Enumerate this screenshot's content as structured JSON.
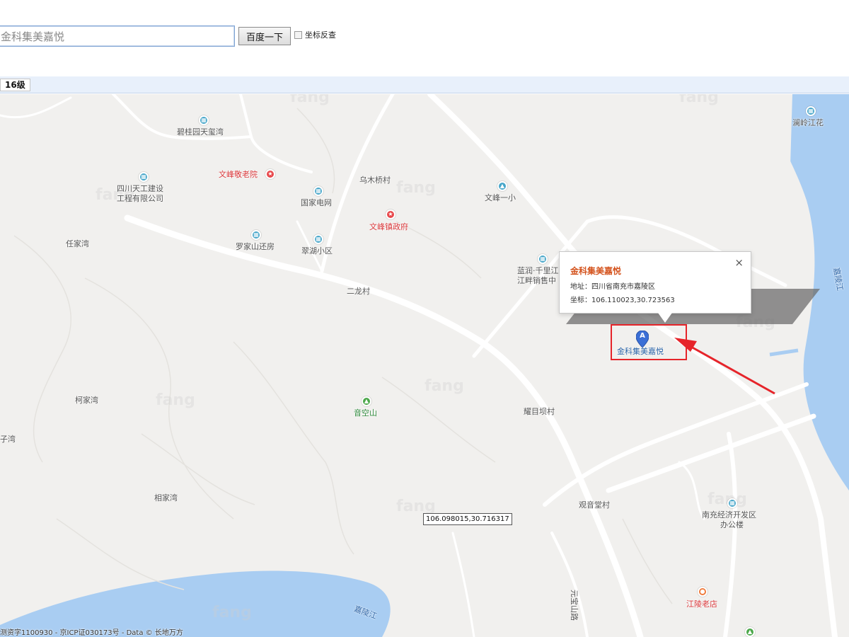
{
  "search": {
    "value": "金科集美嘉悦",
    "button_label": "百度一下",
    "checkbox_label": "坐标反查"
  },
  "zoom": {
    "level": "16级"
  },
  "infowindow": {
    "title": "金科集美嘉悦",
    "address": "地址：四川省南充市嘉陵区",
    "coordinates": "坐标：106.110023,30.723563",
    "close_glyph": "×"
  },
  "marker": {
    "letter": "A",
    "label": "金科集美嘉悦"
  },
  "coord_readout": "106.098015,30.716317",
  "copyright": "测资字1100930 - 京ICP证030173号 - Data © 长地万方",
  "watermark": "fang",
  "colors": {
    "water": "#a9cdf2",
    "land": "#f1f0ee",
    "road": "#ffffff",
    "highlight": "#e6242a",
    "title": "#d4531d"
  },
  "map_labels": {
    "biguiyuan": "碧桂园天玺湾",
    "wenfeng_nursing": "文峰敬老院",
    "sichuan_tiangong": "四川天工建设",
    "sichuan_tiangong_2": "工程有限公司",
    "guojia_dianwang": "国家电网",
    "wumuqiao": "乌木桥村",
    "wenfeng_school": "文峰一小",
    "wenfeng_gov": "文峰镇政府",
    "renjiawan": "任家湾",
    "luojiashan": "罗家山还房",
    "cuihu": "翠湖小区",
    "lanrun": "蓝润·千里江",
    "lanrun_2": "江畔销售中",
    "erlong": "二龙村",
    "lanling": "澜岭江花",
    "kejiawan": "柯家湾",
    "yinkongshan": "音空山",
    "yaomuba": "耀目坝村",
    "zizi": "子湾",
    "xiangjiawan": "相家湾",
    "guanyintang": "观音堂村",
    "nanchong_dev": "南充经济开发区",
    "nanchong_dev_2": "办公楼",
    "jiangling": "江陵老店",
    "yuanzishan": "元宝山路",
    "jialingjiang": "嘉陵江",
    "jiang_right": "嘉陵江"
  }
}
